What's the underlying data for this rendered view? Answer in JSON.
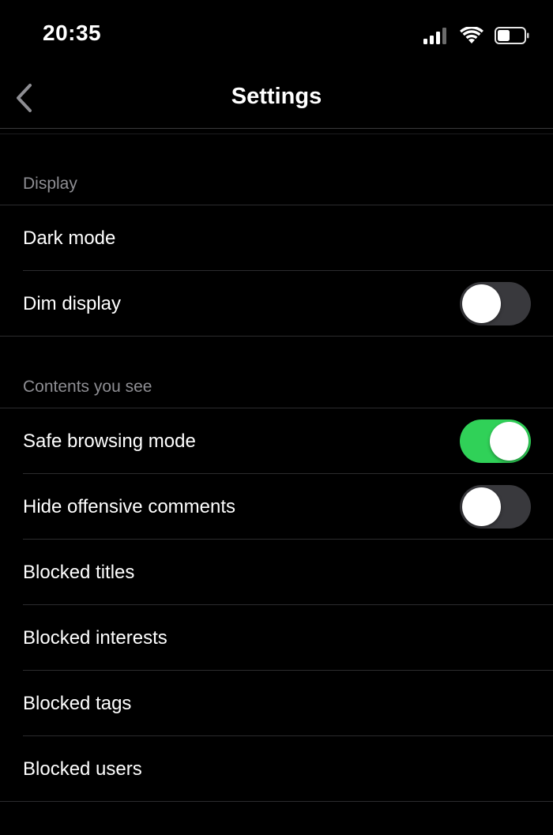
{
  "status_bar": {
    "time": "20:35"
  },
  "nav": {
    "title": "Settings",
    "back_icon": "chevron-left-icon"
  },
  "sections": {
    "display": {
      "header": "Display",
      "dark_mode": {
        "label": "Dark mode"
      },
      "dim_display": {
        "label": "Dim display",
        "on": false
      }
    },
    "contents": {
      "header": "Contents you see",
      "safe_browsing": {
        "label": "Safe browsing mode",
        "on": true
      },
      "hide_offensive": {
        "label": "Hide offensive comments",
        "on": false
      },
      "blocked_titles": {
        "label": "Blocked titles"
      },
      "blocked_interests": {
        "label": "Blocked interests"
      },
      "blocked_tags": {
        "label": "Blocked tags"
      },
      "blocked_users": {
        "label": "Blocked users"
      }
    }
  },
  "colors": {
    "background": "#000000",
    "toggle_on": "#30d158",
    "toggle_off": "#39393d",
    "section_header_text": "#8e8e93"
  }
}
